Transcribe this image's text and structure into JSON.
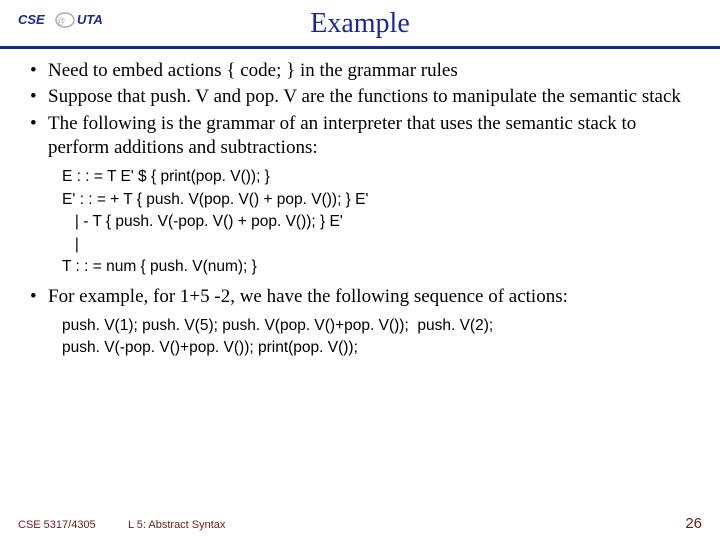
{
  "header": {
    "logo_text_1": "CSE",
    "logo_text_2": "UTA",
    "title": "Example"
  },
  "bullets": {
    "b1": "Need to embed actions  { code; }  in the grammar rules",
    "b2": "Suppose that push. V and pop. V are the functions to manipulate the semantic stack",
    "b3": "The following is the grammar of an interpreter that uses the semantic stack to perform additions and subtractions:",
    "b4": "For example, for 1+5 -2, we have the following sequence of actions:"
  },
  "grammar": {
    "l1": "E : : = T E' $ { print(pop. V()); }",
    "l2": "E' : : = + T { push. V(pop. V() + pop. V()); } E'",
    "l3": "   | - T { push. V(-pop. V() + pop. V()); } E'",
    "l4": "   |",
    "l5": "T : : = num { push. V(num); }"
  },
  "actions": {
    "l1": "push. V(1); push. V(5); push. V(pop. V()+pop. V());  push. V(2);",
    "l2": "push. V(-pop. V()+pop. V()); print(pop. V());"
  },
  "footer": {
    "course": "CSE 5317/4305",
    "lecture": "L 5: Abstract Syntax",
    "page": "26"
  }
}
